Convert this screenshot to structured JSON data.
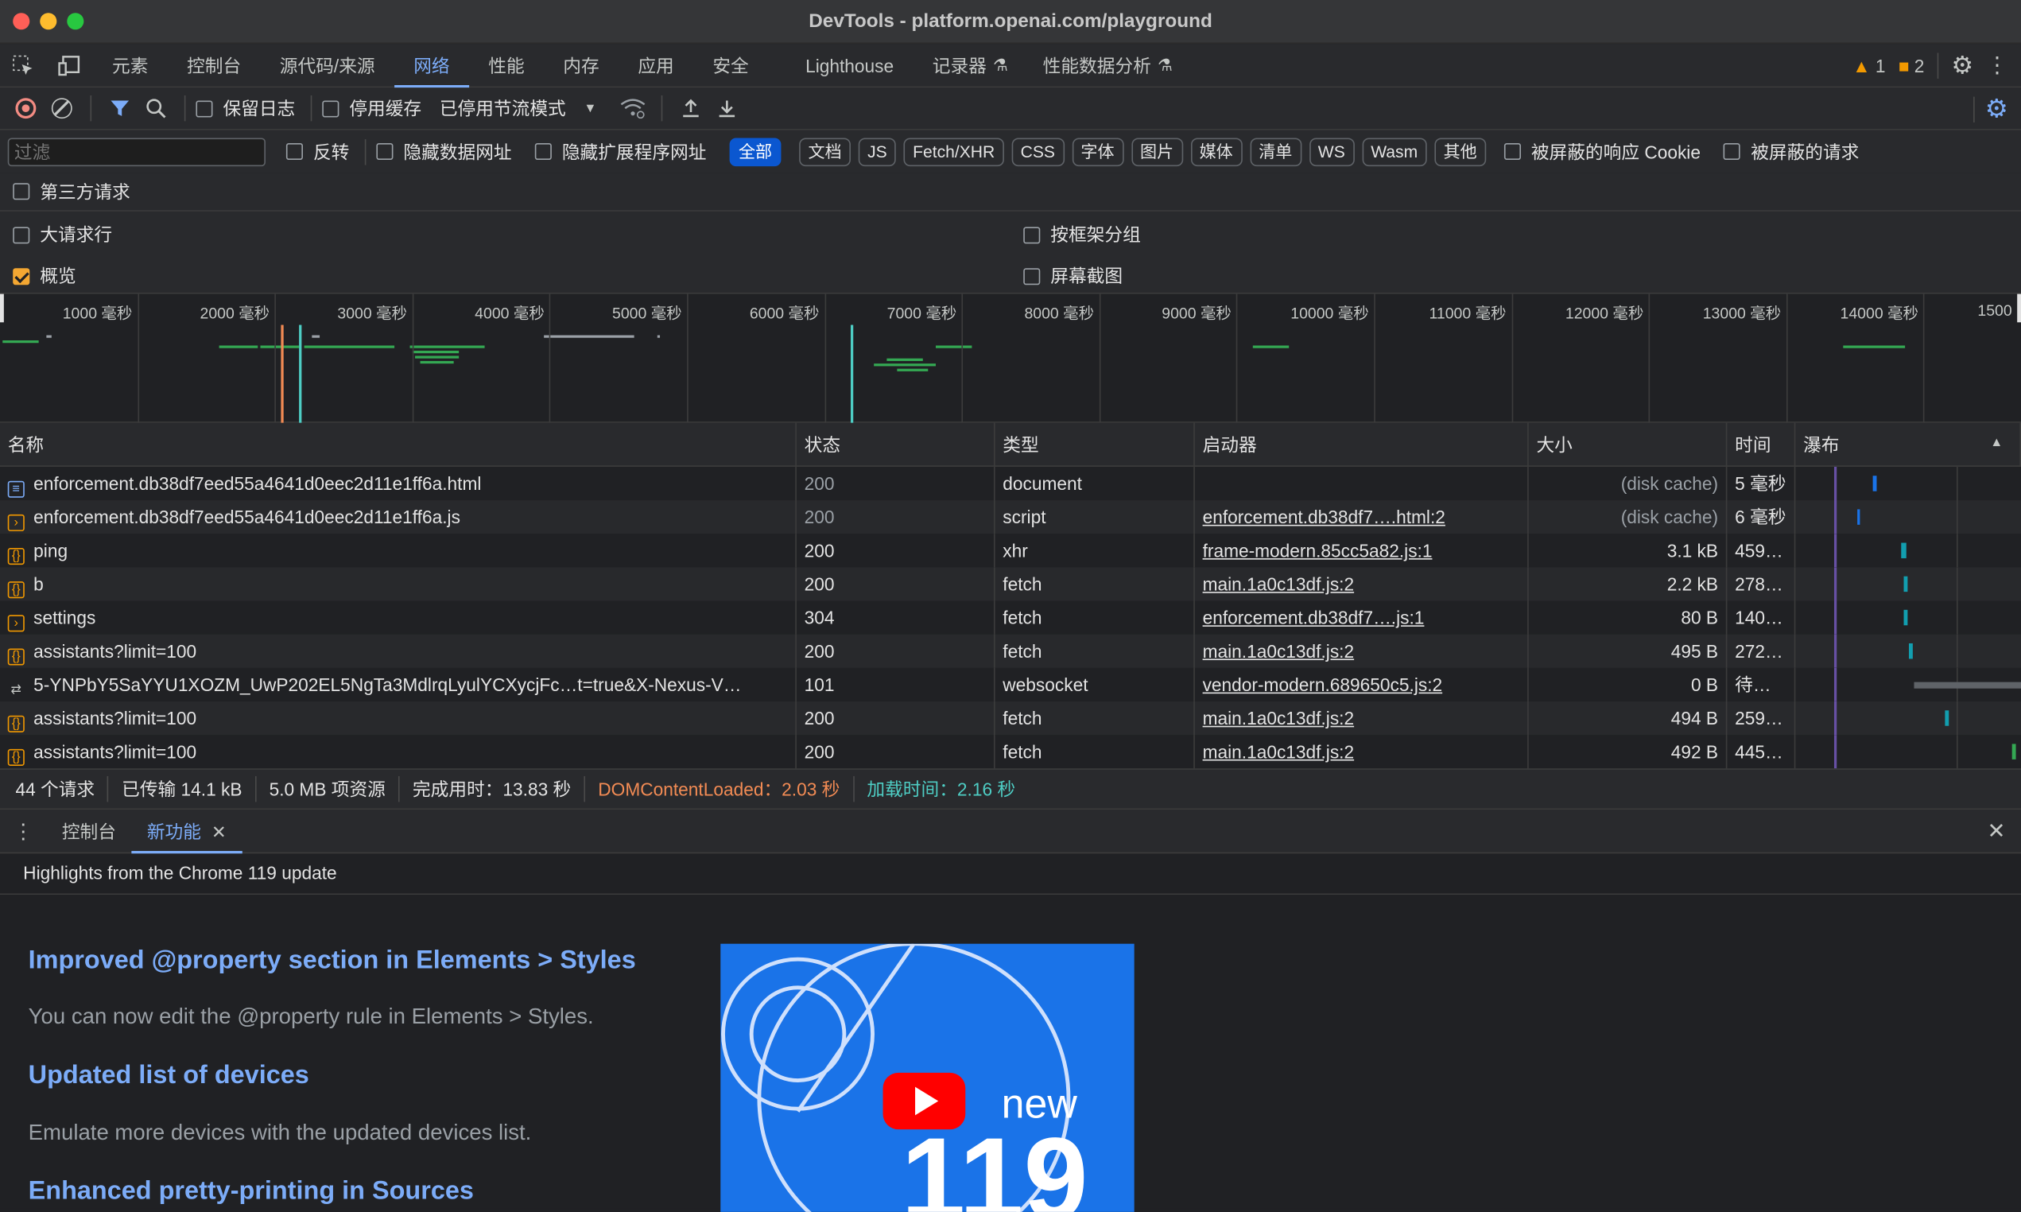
{
  "window": {
    "title": "DevTools - platform.openai.com/playground"
  },
  "panel_tabs": [
    "元素",
    "控制台",
    "源代码/来源",
    "网络",
    "性能",
    "内存",
    "应用",
    "安全",
    "Lighthouse",
    "记录器",
    "性能数据分析"
  ],
  "active_panel": "网络",
  "badges": {
    "warnings": "1",
    "issues": "2"
  },
  "toolbar": {
    "preserve_log": "保留日志",
    "disable_cache": "停用缓存",
    "throttle": "已停用节流模式"
  },
  "filter": {
    "placeholder": "过滤",
    "invert": "反转",
    "hide_data_urls": "隐藏数据网址",
    "hide_ext_urls": "隐藏扩展程序网址",
    "types": [
      "全部",
      "文档",
      "JS",
      "Fetch/XHR",
      "CSS",
      "字体",
      "图片",
      "媒体",
      "清单",
      "WS",
      "Wasm",
      "其他"
    ],
    "active_type": "全部",
    "blocked_cookies": "被屏蔽的响应 Cookie",
    "blocked_requests": "被屏蔽的请求",
    "third_party": "第三方请求"
  },
  "options": {
    "big_rows": "大请求行",
    "overview": "概览",
    "group_by_frame": "按框架分组",
    "screenshots": "屏幕截图"
  },
  "overview_ticks": [
    "1000 毫秒",
    "2000 毫秒",
    "3000 毫秒",
    "4000 毫秒",
    "5000 毫秒",
    "6000 毫秒",
    "7000 毫秒",
    "8000 毫秒",
    "9000 毫秒",
    "10000 毫秒",
    "11000 毫秒",
    "12000 毫秒",
    "13000 毫秒",
    "14000 毫秒",
    "1500"
  ],
  "table": {
    "columns": [
      "名称",
      "状态",
      "类型",
      "启动器",
      "大小",
      "时间",
      "瀑布"
    ],
    "rows": [
      {
        "name": "enforcement.db38df7eed55a4641d0eec2d11e1ff6a.html",
        "status": "200",
        "type": "document",
        "initiator": "",
        "size": "(disk cache)",
        "time": "5 毫秒",
        "icon": "document-icon"
      },
      {
        "name": "enforcement.db38df7eed55a4641d0eec2d11e1ff6a.js",
        "status": "200",
        "type": "script",
        "initiator": "enforcement.db38df7….html:2",
        "size": "(disk cache)",
        "time": "6 毫秒",
        "icon": "script-icon"
      },
      {
        "name": "ping",
        "status": "200",
        "type": "xhr",
        "initiator": "frame-modern.85cc5a82.js:1",
        "size": "3.1 kB",
        "time": "459…",
        "icon": "fetch-icon"
      },
      {
        "name": "b",
        "status": "200",
        "type": "fetch",
        "initiator": "main.1a0c13df.js:2",
        "size": "2.2 kB",
        "time": "278…",
        "icon": "fetch-icon"
      },
      {
        "name": "settings",
        "status": "304",
        "type": "fetch",
        "initiator": "enforcement.db38df7….js:1",
        "size": "80 B",
        "time": "140…",
        "icon": "script-icon"
      },
      {
        "name": "assistants?limit=100",
        "status": "200",
        "type": "fetch",
        "initiator": "main.1a0c13df.js:2",
        "size": "495 B",
        "time": "272…",
        "icon": "fetch-icon"
      },
      {
        "name": "5-YNPbY5SaYYU1XOZM_UwP202EL5NgTa3MdlrqLyulYCXycjFc…t=true&X-Nexus-V…",
        "status": "101",
        "type": "websocket",
        "initiator": "vendor-modern.689650c5.js:2",
        "size": "0 B",
        "time": "待…",
        "icon": "websocket-icon"
      },
      {
        "name": "assistants?limit=100",
        "status": "200",
        "type": "fetch",
        "initiator": "main.1a0c13df.js:2",
        "size": "494 B",
        "time": "259…",
        "icon": "fetch-icon"
      },
      {
        "name": "assistants?limit=100",
        "status": "200",
        "type": "fetch",
        "initiator": "main.1a0c13df.js:2",
        "size": "492 B",
        "time": "445…",
        "icon": "fetch-icon"
      }
    ]
  },
  "summary": {
    "requests": "44 个请求",
    "transferred": "已传输 14.1 kB",
    "resources": "5.0 MB 项资源",
    "finish": "完成用时：13.83 秒",
    "dcl": "DOMContentLoaded：2.03 秒",
    "load": "加载时间：2.16 秒"
  },
  "drawer": {
    "tabs": [
      "控制台",
      "新功能"
    ],
    "active": "新功能",
    "highlights": "Highlights from the Chrome 119 update"
  },
  "whats_new": {
    "items": [
      {
        "heading": "Improved @property section in Elements > Styles",
        "body": "You can now edit the @property rule in Elements > Styles."
      },
      {
        "heading": "Updated list of devices",
        "body": "Emulate more devices with the updated devices list."
      },
      {
        "heading": "Enhanced pretty-printing in Sources",
        "body": ""
      }
    ],
    "promo_word": "new",
    "promo_version": "119"
  },
  "colors": {
    "accent": "#7cacf8",
    "dcl": "#f28b54",
    "load": "#4ecdc4",
    "record": "#f28b82",
    "warning": "#f29900"
  }
}
